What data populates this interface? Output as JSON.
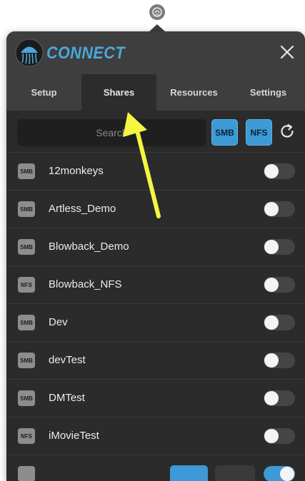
{
  "app": {
    "name": "CONNECT"
  },
  "tabs": [
    {
      "label": "Setup",
      "active": false
    },
    {
      "label": "Shares",
      "active": true
    },
    {
      "label": "Resources",
      "active": false
    },
    {
      "label": "Settings",
      "active": false
    }
  ],
  "toolbar": {
    "search_placeholder": "Search",
    "smb_label": "SMB",
    "nfs_label": "NFS"
  },
  "shares": [
    {
      "type": "SMB",
      "name": "12monkeys",
      "enabled": false
    },
    {
      "type": "SMB",
      "name": "Artless_Demo",
      "enabled": false
    },
    {
      "type": "SMB",
      "name": "Blowback_Demo",
      "enabled": false
    },
    {
      "type": "NFS",
      "name": "Blowback_NFS",
      "enabled": false
    },
    {
      "type": "SMB",
      "name": "Dev",
      "enabled": false
    },
    {
      "type": "SMB",
      "name": "devTest",
      "enabled": false
    },
    {
      "type": "SMB",
      "name": "DMTest",
      "enabled": false
    },
    {
      "type": "NFS",
      "name": "iMovieTest",
      "enabled": false
    }
  ],
  "colors": {
    "accent": "#3d9ad6",
    "annotation_arrow": "#f5f542"
  },
  "icons": {
    "menubar": "connect-menubar-icon",
    "logo": "jellyfish-logo-icon",
    "close": "close-icon",
    "refresh": "refresh-icon",
    "share_type": "share-type-icon"
  }
}
